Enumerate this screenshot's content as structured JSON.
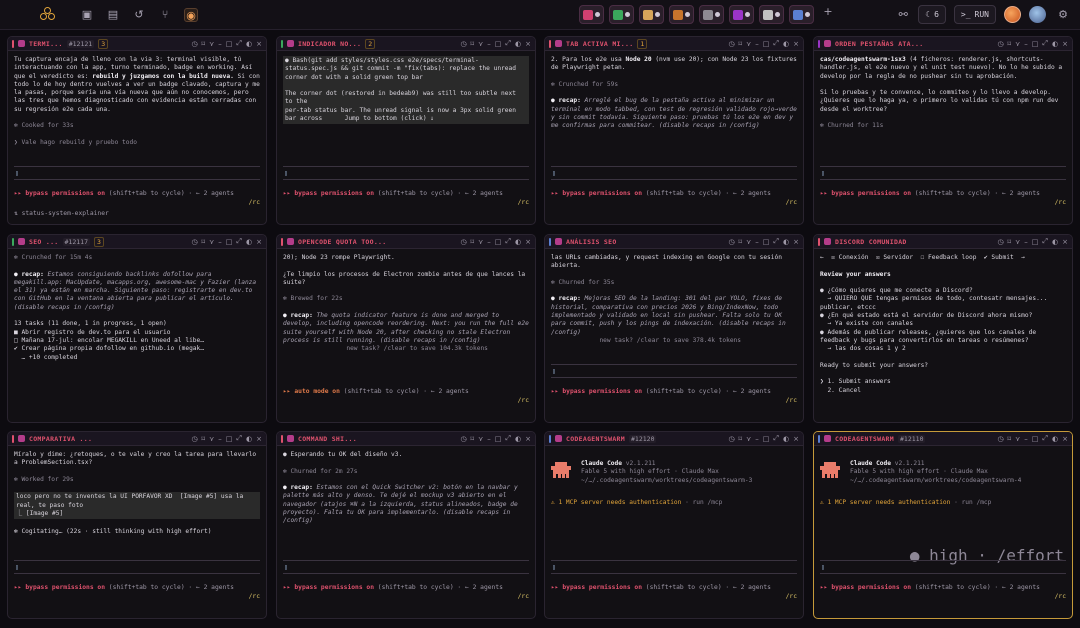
{
  "topbar": {
    "run_label": "RUN",
    "count": "6",
    "chip_colors": [
      "#d04070",
      "#3aa85c",
      "#d6a55a",
      "#c7742c",
      "#8e8a92",
      "#9a34c7",
      "#c0c0c0",
      "#5a7fd1"
    ]
  },
  "panes": [
    {
      "title": "TERMI...",
      "num": "#12121",
      "count": "3",
      "bar_color": "#e0526e",
      "lines": [
        {
          "t": "Tu captura encaja de lleno con la via 3: terminal visible, tú interactuando con la app, turno terminado, badge en working. Así que el veredicto es: "
        },
        {
          "t": "rebuild y juzgamos con la build nueva.",
          "c": "bold"
        },
        {
          "t": " Si con todo lo de hoy dentro vuelves a ver un badge clavado, captura y me la pasas, porque sería una vía nueva que aún no conocemos, pero las tres que hemos diagnosticado con evidencia están cerradas con su regresión e2e cada una.\n\n"
        },
        {
          "t": "✻ Cooked for 33s\n\n",
          "c": "dim"
        },
        {
          "t": "❯ Vale hago rebuild y pruebo todo",
          "c": "dim"
        }
      ],
      "prompt": "▯",
      "perm_mode": "bypass permissions on",
      "perm_rest": " (shift+tab to cycle) · ← 2 agents",
      "rc": "/rc",
      "footer": "⇅  status-system-explainer"
    },
    {
      "title": "INDICADOR NO...",
      "num": "",
      "count": "2",
      "bar_color": "#3aa85c",
      "lines": [
        {
          "t": "● Bash(git add styles/styles.css e2e/specs/terminal-status.spec.js && git commit -m \"fix(tabs): replace the unread corner dot with a solid green top bar\n\nThe corner dot (restored in bedeab9) was still too subtle next to the\nper-tab status bar. The unread signal is now a 3px solid green bar across      Jump to bottom (click) ↓",
          "c": "hl"
        }
      ],
      "prompt": "▯",
      "perm_mode": "bypass permissions on",
      "perm_rest": " (shift+tab to cycle) · ← 2 agents",
      "rc": "/rc",
      "footer": ""
    },
    {
      "title": "TAB ACTIVA MI...",
      "num": "",
      "count": "1",
      "bar_color": "#e0526e",
      "lines": [
        {
          "t": "2. Para los e2e usa "
        },
        {
          "t": "Node 20",
          "c": "bold"
        },
        {
          "t": " (nvm use 20); con Node 23 los fixtures de Playwright petan.\n\n"
        },
        {
          "t": "✻ Crunched for 59s\n\n",
          "c": "dim"
        },
        {
          "t": "● recap: ",
          "c": "bold"
        },
        {
          "t": "Arreglé el bug de la pestaña activa al minimizar un terminal en modo tabbed, con test de regresión validado rojo→verde y sin commit todavía. Siguiente paso: pruebas tú los e2e en dev y me confirmas para commitear. (disable recaps in /config)",
          "c": "it"
        }
      ],
      "prompt": "▯",
      "perm_mode": "bypass permissions on",
      "perm_rest": " (shift+tab to cycle) · ← 2 agents",
      "rc": "/rc",
      "footer": ""
    },
    {
      "title": "ORDEN PESTAÑAS ATA...",
      "num": "",
      "count": "",
      "bar_color": "#9a34c7",
      "lines": [
        {
          "t": "cas/codeagentswarm-1sx3",
          "c": "bold"
        },
        {
          "t": " (4 ficheros: renderer.js, shortcuts-handler.js, el e2e nuevo y el unit test nuevo). No lo he subido a develop por la regla de no pushear sin tu aprobación.\n\nSi lo pruebas y te convence, lo commiteo y lo llevo a develop. ¿Quieres que lo haga ya, o primero lo validas tú con npm run dev desde el worktree?\n\n"
        },
        {
          "t": "✻ Churned for 11s",
          "c": "dim"
        }
      ],
      "prompt": "▯",
      "perm_mode": "bypass permissions on",
      "perm_rest": " (shift+tab to cycle) · ← 2 agents",
      "rc": "/rc",
      "footer": ""
    },
    {
      "title": "SEO ...",
      "num": "#12117",
      "count": "3",
      "bar_color": "#3aa85c",
      "lines": [
        {
          "t": "✻ Crunched for 15m 4s\n\n",
          "c": "dim"
        },
        {
          "t": "● recap: ",
          "c": "bold"
        },
        {
          "t": "Estamos consiguiendo backlinks dofollow para megakill.app: MacUpdate, macapps.org, awesome-mac y Fazier (lanza el 31) ya están en marcha. Siguiente paso: registrarte en dev.to con GitHub en la ventana abierta para publicar el artículo. (disable recaps in /config)\n\n",
          "c": "it"
        },
        {
          "t": "13 tasks (11 done, 1 in progress, 1 open)\n■ Abrir registro de dev.to para el usuario\n□ Mañana 17-jul: encolar MEGAKILL en Uneed al libe…\n✔ Crear página propia dofollow en github.io (megak…\n  … +10 completed"
        }
      ],
      "prompt": "",
      "perm_mode": "",
      "perm_rest": "",
      "rc": "",
      "footer": ""
    },
    {
      "title": "OPENCODE QUOTA TOO...",
      "num": "",
      "count": "",
      "bar_color": "#e0526e",
      "lines": [
        {
          "t": "20); Node 23 rompe Playwright.\n\n¿Te limpio los procesos de Electron zombie antes de que lances la suite?\n\n"
        },
        {
          "t": "✻ Brewed for 22s\n\n",
          "c": "dim"
        },
        {
          "t": "● recap: ",
          "c": "bold"
        },
        {
          "t": "The quota indicator feature is done and merged to develop, including opencode reordering. Next: you run the full e2e suite yourself with Node 20, after checking no stale Electron process is still running. (disable recaps in /config)",
          "c": "it"
        },
        {
          "t": "\n                 new task? /clear to save 104.3k tokens",
          "c": "dim"
        }
      ],
      "prompt": "",
      "perm_mode": "auto mode on",
      "perm_rest": " (shift+tab to cycle) · ← 2 agents",
      "rc": "/rc",
      "footer": ""
    },
    {
      "title": "ANÁLISIS SEO",
      "num": "",
      "count": "",
      "bar_color": "#5a7fd1",
      "lines": [
        {
          "t": "las URLs cambiadas, y request indexing en Google con tu sesión abierta.\n\n"
        },
        {
          "t": "✻ Churned for 35s\n\n",
          "c": "dim"
        },
        {
          "t": "● recap: ",
          "c": "bold"
        },
        {
          "t": "Mejoras SEO de la landing: 301 del par YOLO, fixes de historial, comparativa con precios 2026 y Bing/IndexNow, todo implementado y validado en local sin pushear. Falta solo tu OK para commit, push y los pings de indexación. (disable recaps in /config)",
          "c": "it"
        },
        {
          "t": "\n             new task? /clear to save 378.4k tokens",
          "c": "dim"
        }
      ],
      "prompt": "▯",
      "perm_mode": "bypass permissions on",
      "perm_rest": " (shift+tab to cycle) · ← 2 agents",
      "rc": "/rc",
      "footer": ""
    },
    {
      "title": "DISCORD COMUNIDAD",
      "num": "",
      "count": "",
      "bar_color": "#e0526e",
      "lines": [
        {
          "t": "←  ☒ Conexión  ☒ Servidor  ☐ Feedback loop  ✔ Submit  →\n\n"
        },
        {
          "t": "Review your answers\n\n",
          "c": "bold"
        },
        {
          "t": "● ¿Cómo quieres que me conecte a Discord?\n  → QUIERO QUE tengas permisos de todo, contesatr mensajes... publicar, etccc\n● ¿En qué estado está el servidor de Discord ahora mismo?\n  → Ya existe con canales\n● Además de publicar releases, ¿quieres que los canales de feedback y bugs para convertirlos en tareas o resúmenes?\n  → las dos cosas 1 y 2\n\nReady to submit your answers?\n\n❯ 1. Submit answers\n  2. Cancel"
        }
      ],
      "prompt": "",
      "perm_mode": "",
      "perm_rest": "",
      "rc": "",
      "footer": ""
    },
    {
      "title": "COMPARATIVA ...",
      "num": "",
      "count": "",
      "bar_color": "#e0526e",
      "lines": [
        {
          "t": "Míralo y dime: ¿retoques, o te vale y creo la tarea para llevarlo a ProblemSection.tsx?\n\n"
        },
        {
          "t": "✻ Worked for 29s\n\n",
          "c": "dim"
        },
        {
          "t": "loco pero no te inventes la UI PORFAVOR XD  [Image #5] usa la real, te paso foto\n⎿ [Image #5]",
          "c": "hl"
        },
        {
          "t": "\n✻ Cogitating… (22s · still thinking with high effort)"
        }
      ],
      "prompt": "▯",
      "perm_mode": "bypass permissions on",
      "perm_rest": " (shift+tab to cycle) · ← 2 agents",
      "rc": "/rc",
      "footer": ""
    },
    {
      "title": "COMMAND SHI...",
      "num": "",
      "count": "",
      "bar_color": "#e0526e",
      "lines": [
        {
          "t": "● Esperando tu OK del diseño v3.\n\n"
        },
        {
          "t": "✻ Churned for 2m 27s\n\n",
          "c": "dim"
        },
        {
          "t": "● recap: ",
          "c": "bold"
        },
        {
          "t": "Estamos con el Quick Switcher v2: botón en la navbar y palette más alto y denso. Te dejé el mockup v3 abierto en el navegador (atajos ⌘N a la izquierda, status alineados, badge de proyecto). Falta tu OK para implementarlo. (disable recaps in /config)",
          "c": "it"
        }
      ],
      "prompt": "▯",
      "perm_mode": "bypass permissions on",
      "perm_rest": " (shift+tab to cycle) · ← 2 agents",
      "rc": "/rc",
      "footer": ""
    },
    {
      "title": "CODEAGENTSWARM",
      "num": "#12120",
      "count": "",
      "bar_color": "#5a7fd1",
      "splash": true,
      "splash_title": "Claude Code",
      "splash_ver": "v2.1.211",
      "splash_line1": "Fable 5 with high effort · Claude Max",
      "splash_line2": "~/…/.codeagentswarm/worktrees/codeagentswarm-3",
      "mcp": "1 MCP server needs authentication",
      "mcp_rest": " · run /mcp",
      "effort": "",
      "prompt": "▯",
      "perm_mode": "bypass permissions on",
      "perm_rest": " (shift+tab to cycle) · ← 2 agents",
      "rc": "/rc",
      "footer": ""
    },
    {
      "title": "CODEAGENTSWARM",
      "num": "#12110",
      "count": "",
      "bar_color": "#5a7fd1",
      "splash": true,
      "splash_title": "Claude Code",
      "splash_ver": "v2.1.211",
      "splash_line1": "Fable 5 with high effort · Claude Max",
      "splash_line2": "~/…/.codeagentswarm/worktrees/codeagentswarm-4",
      "mcp": "1 MCP server needs authentication",
      "mcp_rest": " · run /mcp",
      "effort": "● high · /effort",
      "prompt": "▯",
      "perm_mode": "bypass permissions on",
      "perm_rest": " (shift+tab to cycle) · ← 2 agents",
      "rc": "/rc",
      "footer": ""
    }
  ]
}
